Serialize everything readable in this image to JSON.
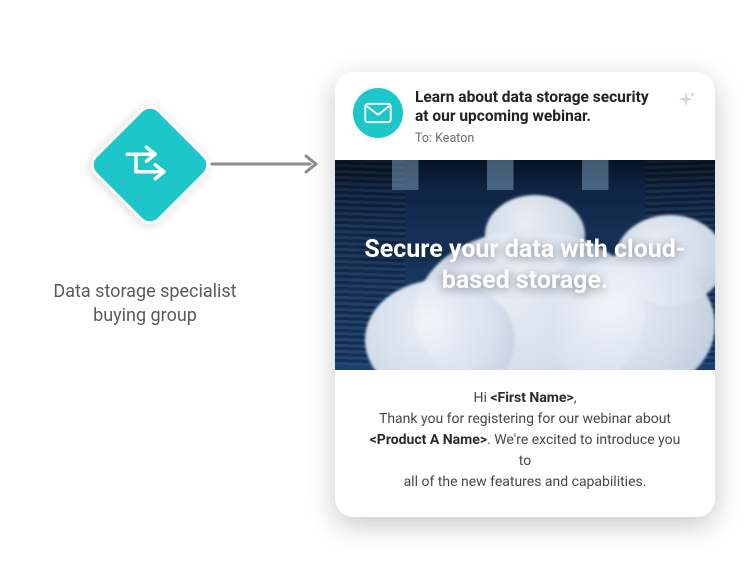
{
  "node": {
    "label_line1": "Data storage specialist",
    "label_line2": "buying group"
  },
  "email": {
    "subject": "Learn about data storage security at our upcoming webinar.",
    "to_prefix": "To: ",
    "to_name": "Keaton",
    "hero_headline": "Secure your data with cloud-based storage.",
    "body": {
      "greeting_prefix": "Hi ",
      "first_name_token": "<First Name>",
      "greeting_suffix": ",",
      "line2_a": "Thank you for registering for our webinar about",
      "product_token": "<Product A Name>",
      "line3_b": ". We're excited to introduce you to",
      "line4": "all of the new features and capabilities."
    }
  }
}
